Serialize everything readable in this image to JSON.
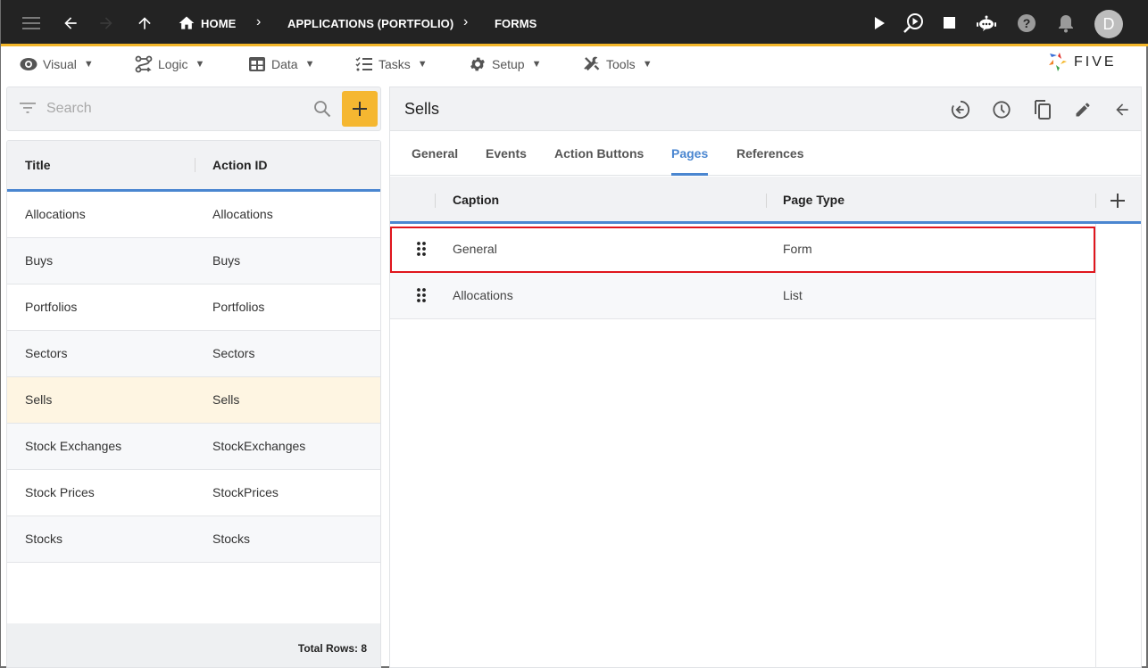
{
  "topbar": {
    "breadcrumbs": [
      {
        "label": "HOME",
        "icon": "home-icon"
      },
      {
        "label": "APPLICATIONS (PORTFOLIO)"
      },
      {
        "label": "FORMS"
      }
    ],
    "avatar_letter": "D",
    "accent_color": "#f4b72a"
  },
  "menubar": {
    "items": [
      {
        "label": "Visual",
        "icon": "eye-icon"
      },
      {
        "label": "Logic",
        "icon": "logic-flow-icon"
      },
      {
        "label": "Data",
        "icon": "table-icon"
      },
      {
        "label": "Tasks",
        "icon": "checklist-icon"
      },
      {
        "label": "Setup",
        "icon": "gear-icon"
      },
      {
        "label": "Tools",
        "icon": "tools-icon"
      }
    ],
    "caret": "▼",
    "logo_text": "FIVE"
  },
  "search": {
    "placeholder": "Search",
    "value": ""
  },
  "list": {
    "columns": [
      "Title",
      "Action ID"
    ],
    "rows": [
      {
        "title": "Allocations",
        "action_id": "Allocations"
      },
      {
        "title": "Buys",
        "action_id": "Buys"
      },
      {
        "title": "Portfolios",
        "action_id": "Portfolios"
      },
      {
        "title": "Sectors",
        "action_id": "Sectors"
      },
      {
        "title": "Sells",
        "action_id": "Sells",
        "selected": true
      },
      {
        "title": "Stock Exchanges",
        "action_id": "StockExchanges"
      },
      {
        "title": "Stock Prices",
        "action_id": "StockPrices"
      },
      {
        "title": "Stocks",
        "action_id": "Stocks"
      }
    ],
    "footer": "Total Rows: 8"
  },
  "detail": {
    "title": "Sells",
    "tabs": [
      {
        "label": "General"
      },
      {
        "label": "Events"
      },
      {
        "label": "Action Buttons"
      },
      {
        "label": "Pages",
        "active": true
      },
      {
        "label": "References"
      }
    ],
    "grid": {
      "columns": [
        "Caption",
        "Page Type"
      ],
      "rows": [
        {
          "caption": "General",
          "page_type": "Form",
          "highlighted": true
        },
        {
          "caption": "Allocations",
          "page_type": "List"
        }
      ]
    }
  }
}
